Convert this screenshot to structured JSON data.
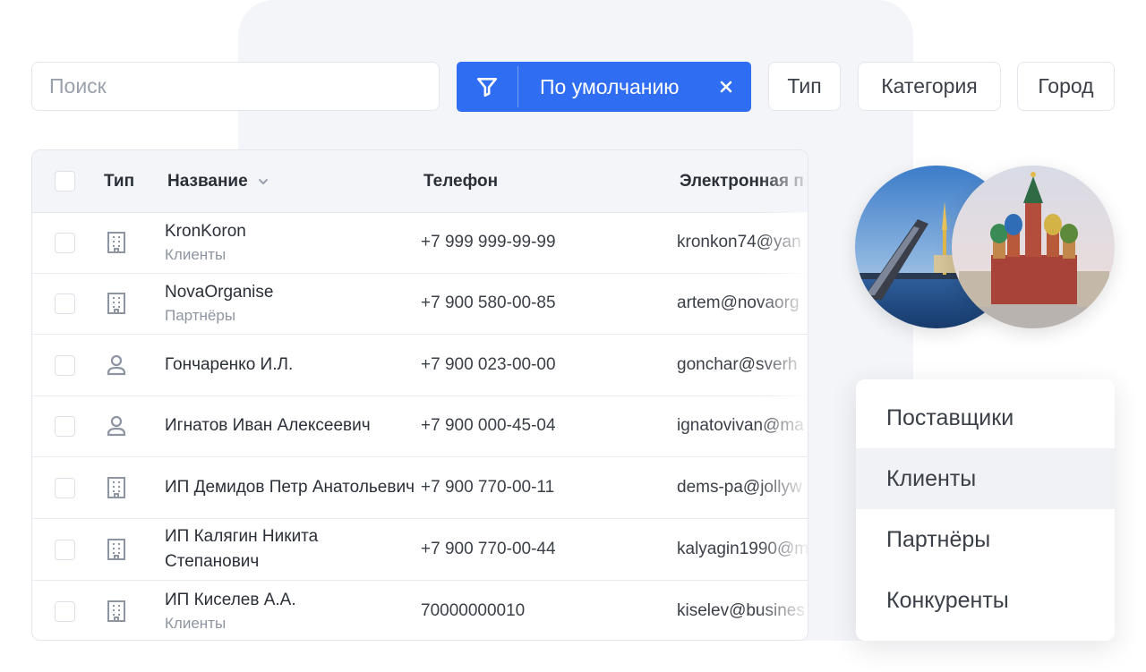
{
  "search": {
    "placeholder": "Поиск"
  },
  "filter_chip": {
    "label": "По умолчанию",
    "filter_icon": "filter-icon",
    "close_icon": "close-icon",
    "color": "#2f6df2"
  },
  "filter_buttons": [
    "Тип",
    "Категория",
    "Город"
  ],
  "table": {
    "headers": {
      "type": "Тип",
      "name": "Название",
      "phone": "Телефон",
      "email": "Электронная п"
    },
    "rows": [
      {
        "icon": "building-icon",
        "name": "KronKoron",
        "category": "Клиенты",
        "phone": "+7 999 999-99-99",
        "email": "kronkon74@yan"
      },
      {
        "icon": "building-icon",
        "name": "NovaOrganise",
        "category": "Партнёры",
        "phone": "+7 900 580-00-85",
        "email": "artem@novaorg"
      },
      {
        "icon": "person-icon",
        "name": "Гончаренко И.Л.",
        "category": "",
        "phone": "+7 900 023-00-00",
        "email": "gonchar@sverh"
      },
      {
        "icon": "person-icon",
        "name": "Игнатов Иван Алексеевич",
        "category": "",
        "phone": "+7 900 000-45-04",
        "email": "ignatovivan@ma"
      },
      {
        "icon": "building-icon",
        "name": "ИП Демидов Петр Анатольевич",
        "category": "",
        "phone": "+7 900 770-00-11",
        "email": "dems-pa@jollyw"
      },
      {
        "icon": "building-icon",
        "name": "ИП Калягин Никита Степанович",
        "category": "",
        "phone": "+7 900 770-00-44",
        "email": "kalyagin1990@m"
      },
      {
        "icon": "building-icon",
        "name": "ИП Киселев А.А.",
        "category": "Клиенты",
        "phone": "70000000010",
        "email": "kiselev@busines"
      }
    ]
  },
  "dropdown": {
    "items": [
      "Поставщики",
      "Клиенты",
      "Партнёры",
      "Конкуренты"
    ],
    "active_index": 1
  },
  "images": [
    "saint-petersburg-bridge-photo",
    "moscow-st-basils-cathedral-photo"
  ]
}
